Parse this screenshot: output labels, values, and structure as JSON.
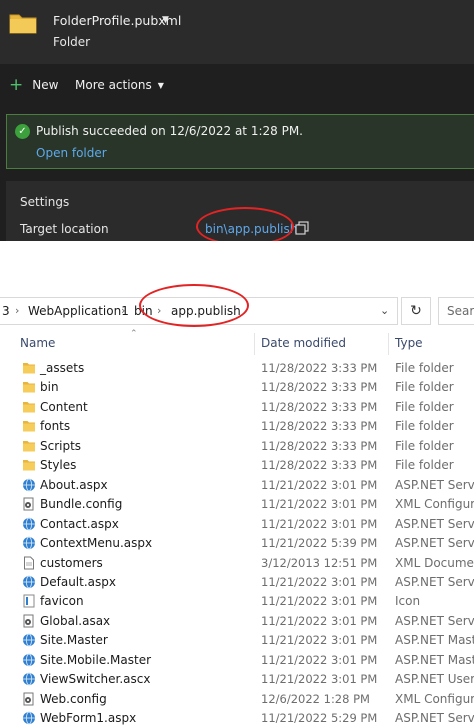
{
  "vs": {
    "profile_name": "FolderProfile.pubxml",
    "profile_subtitle": "Folder",
    "toolbar": {
      "new_label": "New",
      "more_actions_label": "More actions"
    },
    "success": {
      "message": "Publish succeeded on 12/6/2022 at 1:28 PM.",
      "link": "Open folder"
    },
    "settings": {
      "title": "Settings",
      "target_label": "Target location",
      "target_value": "bin\\app.publish\\"
    }
  },
  "explorer": {
    "breadcrumb": [
      "3",
      "WebApplication1",
      "bin",
      "app.publish"
    ],
    "search_placeholder": "Search",
    "columns": {
      "name": "Name",
      "date": "Date modified",
      "type": "Type"
    },
    "files": [
      {
        "name": "_assets",
        "date": "11/28/2022 3:33 PM",
        "type": "File folder",
        "icon": "folder"
      },
      {
        "name": "bin",
        "date": "11/28/2022 3:33 PM",
        "type": "File folder",
        "icon": "folder"
      },
      {
        "name": "Content",
        "date": "11/28/2022 3:33 PM",
        "type": "File folder",
        "icon": "folder"
      },
      {
        "name": "fonts",
        "date": "11/28/2022 3:33 PM",
        "type": "File folder",
        "icon": "folder"
      },
      {
        "name": "Scripts",
        "date": "11/28/2022 3:33 PM",
        "type": "File folder",
        "icon": "folder"
      },
      {
        "name": "Styles",
        "date": "11/28/2022 3:33 PM",
        "type": "File folder",
        "icon": "folder"
      },
      {
        "name": "About.aspx",
        "date": "11/21/2022 3:01 PM",
        "type": "ASP.NET Server Page",
        "icon": "globe"
      },
      {
        "name": "Bundle.config",
        "date": "11/21/2022 3:01 PM",
        "type": "XML Configuration File",
        "icon": "config"
      },
      {
        "name": "Contact.aspx",
        "date": "11/21/2022 3:01 PM",
        "type": "ASP.NET Server Page",
        "icon": "globe"
      },
      {
        "name": "ContextMenu.aspx",
        "date": "11/21/2022 5:39 PM",
        "type": "ASP.NET Server Page",
        "icon": "globe"
      },
      {
        "name": "customers",
        "date": "3/12/2013 12:51 PM",
        "type": "XML Document",
        "icon": "doc"
      },
      {
        "name": "Default.aspx",
        "date": "11/21/2022 3:01 PM",
        "type": "ASP.NET Server Page",
        "icon": "globe"
      },
      {
        "name": "favicon",
        "date": "11/21/2022 3:01 PM",
        "type": "Icon",
        "icon": "favicon"
      },
      {
        "name": "Global.asax",
        "date": "11/21/2022 3:01 PM",
        "type": "ASP.NET Server Application",
        "icon": "config"
      },
      {
        "name": "Site.Master",
        "date": "11/21/2022 3:01 PM",
        "type": "ASP.NET Master Page",
        "icon": "globe"
      },
      {
        "name": "Site.Mobile.Master",
        "date": "11/21/2022 3:01 PM",
        "type": "ASP.NET Master Page",
        "icon": "globe"
      },
      {
        "name": "ViewSwitcher.ascx",
        "date": "11/21/2022 3:01 PM",
        "type": "ASP.NET User Control",
        "icon": "globe"
      },
      {
        "name": "Web.config",
        "date": "12/6/2022 1:28 PM",
        "type": "XML Configuration File",
        "icon": "config"
      },
      {
        "name": "WebForm1.aspx",
        "date": "11/21/2022 5:29 PM",
        "type": "ASP.NET Server Page",
        "icon": "globe"
      }
    ]
  }
}
